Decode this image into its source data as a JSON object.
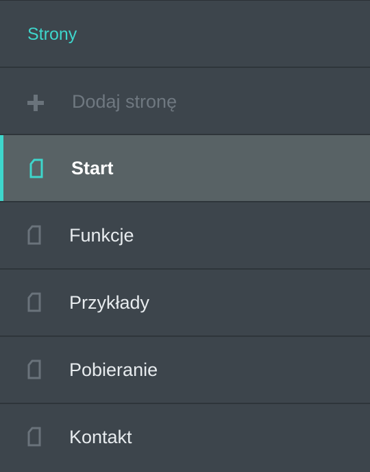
{
  "panel": {
    "title": "Strony",
    "add_page_label": "Dodaj stronę",
    "active_index": 0,
    "pages": [
      {
        "label": "Start",
        "icon": "page-icon",
        "active": true
      },
      {
        "label": "Funkcje",
        "icon": "page-icon",
        "active": false
      },
      {
        "label": "Przykłady",
        "icon": "page-icon",
        "active": false
      },
      {
        "label": "Pobieranie",
        "icon": "page-icon",
        "active": false
      },
      {
        "label": "Kontakt",
        "icon": "page-icon",
        "active": false
      }
    ]
  },
  "colors": {
    "background": "#3d454c",
    "active_background": "#586265",
    "accent": "#3ed6cc",
    "muted": "#6f7880",
    "text": "#e7ebee",
    "divider": "#2e353a"
  }
}
